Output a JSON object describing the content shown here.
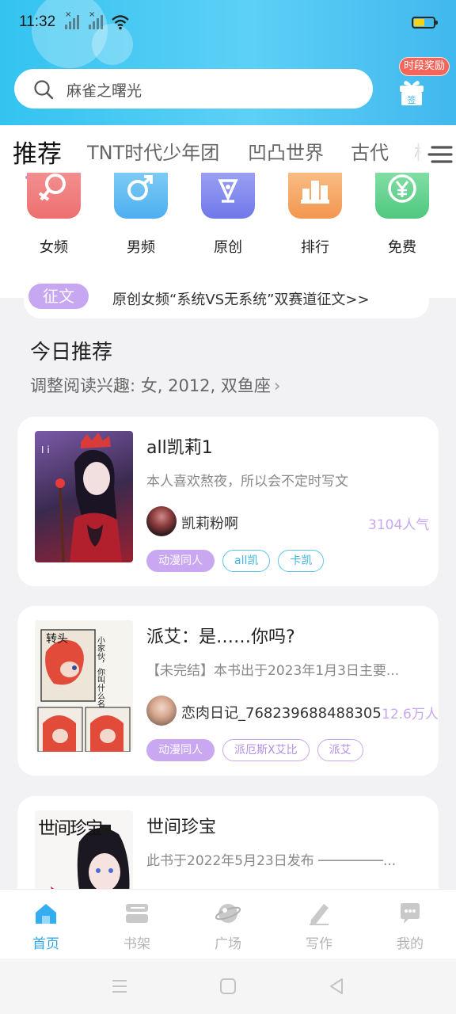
{
  "status_bar": {
    "time": "11:32",
    "battery_level": 0.55,
    "battery_color": "#f5d21a"
  },
  "search": {
    "placeholder": "麻雀之曙光",
    "icon": "search-icon"
  },
  "reward": {
    "badge": "时段奖励",
    "gift_label": "签",
    "icon": "gift-icon"
  },
  "tabs": [
    {
      "label": "推荐",
      "active": true
    },
    {
      "label": "TNT时代少年团"
    },
    {
      "label": "凹凸世界"
    },
    {
      "label": "古代"
    },
    {
      "label": "校"
    }
  ],
  "categories": [
    {
      "label": "女频",
      "icon": "female-icon",
      "color": "#f07a7a"
    },
    {
      "label": "男频",
      "icon": "male-icon",
      "color": "#5ab8f2"
    },
    {
      "label": "原创",
      "icon": "pen-nib-icon",
      "color": "#7d84ee"
    },
    {
      "label": "排行",
      "icon": "ranking-icon",
      "color": "#f5a35c"
    },
    {
      "label": "免费",
      "icon": "yen-icon",
      "color": "#5ed08c"
    }
  ],
  "notice": {
    "tag": "征文",
    "text": "原创女频“系统VS无系统”双赛道征文>>"
  },
  "section": {
    "title": "今日推荐",
    "subtitle": "调整阅读兴趣: 女, 2012, 双鱼座"
  },
  "books": [
    {
      "title": "all凯莉1",
      "desc": "本人喜欢熬夜，所以会不定时写文",
      "author": "凯莉粉啊",
      "popularity": "3104人气",
      "tags": [
        {
          "label": "动漫同人",
          "style": "filled"
        },
        {
          "label": "all凯",
          "style": "teal"
        },
        {
          "label": "卡凯",
          "style": "teal"
        }
      ]
    },
    {
      "title": "派艾：是……你吗?",
      "desc": "【未完结】本书出于2023年1月3日主要...",
      "author": "恋肉日记_768239688488305",
      "popularity": "12.6万人气",
      "cover_text_1": "转头",
      "cover_text_2": "小家伙，你叫什么名字?",
      "tags": [
        {
          "label": "动漫同人",
          "style": "filled"
        },
        {
          "label": "派厄斯X艾比",
          "style": "purple"
        },
        {
          "label": "派艾",
          "style": "purple"
        }
      ]
    },
    {
      "title": "世间珍宝",
      "desc": "此书于2022年5月23日发布 ────────...",
      "cover_text": "世间珍宝"
    }
  ],
  "bottom_nav": [
    {
      "label": "首页",
      "icon": "home-icon",
      "active": true
    },
    {
      "label": "书架",
      "icon": "bookshelf-icon"
    },
    {
      "label": "广场",
      "icon": "planet-icon"
    },
    {
      "label": "写作",
      "icon": "edit-icon"
    },
    {
      "label": "我的",
      "icon": "message-icon"
    }
  ],
  "colors": {
    "accent": "#2aa7e8",
    "purple": "#c7a6f2",
    "header_gradient_start": "#33c3f0"
  }
}
